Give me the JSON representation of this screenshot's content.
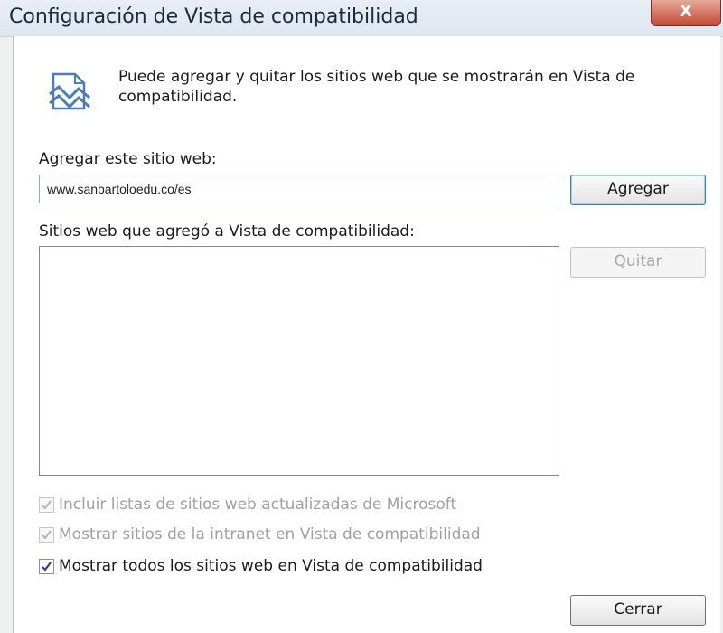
{
  "window": {
    "title": "Configuración de Vista de compatibilidad",
    "close_glyph": "X"
  },
  "info": {
    "icon": "compatibility-view-icon",
    "text": "Puede agregar y quitar los sitios web que se mostrarán en Vista de compatibilidad."
  },
  "add_site": {
    "label": "Agregar este sitio web:",
    "value": "www.sanbartoloedu.co/es",
    "button": "Agregar"
  },
  "sites_list": {
    "label": "Sitios web que agregó a Vista de compatibilidad:",
    "items": [],
    "remove_button": "Quitar"
  },
  "options": [
    {
      "label": "Incluir listas de sitios web actualizadas de Microsoft",
      "checked": true,
      "enabled": false
    },
    {
      "label": "Mostrar sitios de la intranet en Vista de compatibilidad",
      "checked": true,
      "enabled": false
    },
    {
      "label": "Mostrar todos los sitios web en Vista de compatibilidad",
      "checked": true,
      "enabled": true
    }
  ],
  "footer": {
    "close_button": "Cerrar"
  },
  "colors": {
    "checkmark_disabled": "#b5b5b5",
    "checkmark_enabled": "#2a3f8f",
    "icon_blue": "#4a7fb5"
  }
}
